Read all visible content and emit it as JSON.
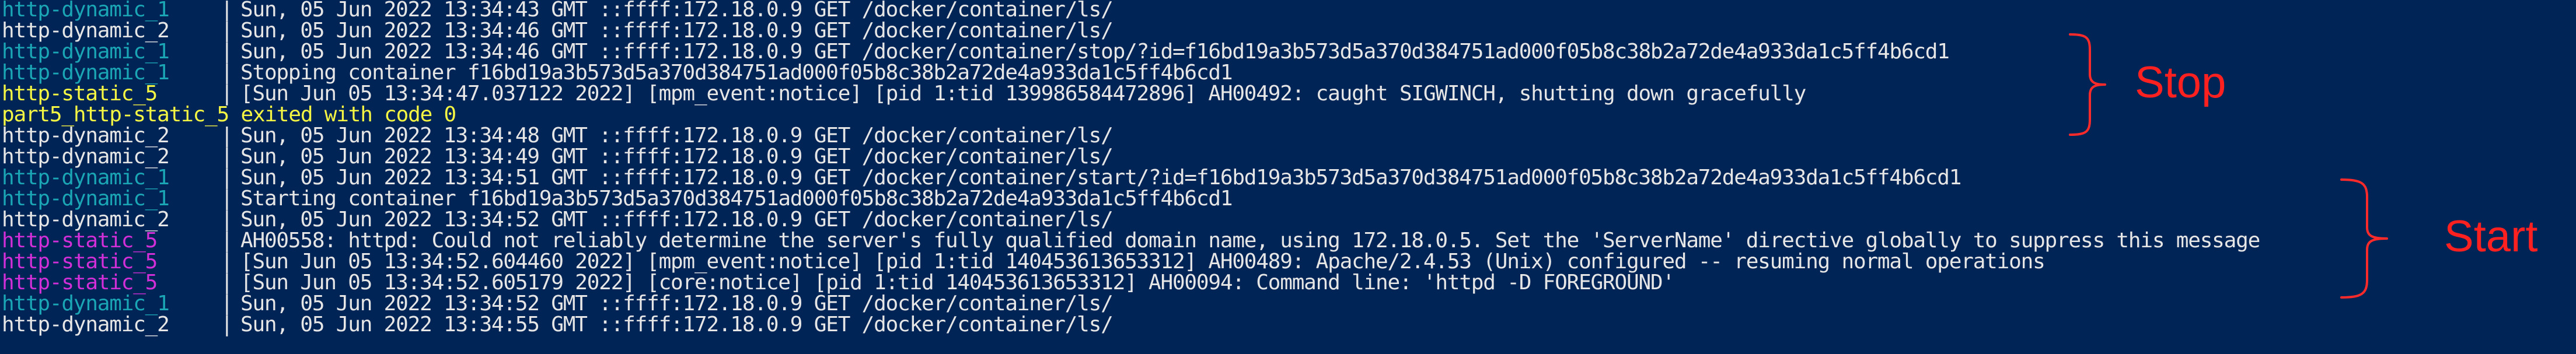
{
  "terminal": {
    "lines": [
      {
        "service": "http-dynamic_1",
        "service_color": "cyan",
        "separator": "|",
        "message": "Sun, 05 Jun 2022 13:34:43 GMT ::ffff:172.18.0.9 GET /docker/container/ls/"
      },
      {
        "service": "http-dynamic_2",
        "service_color": "white",
        "separator": "|",
        "message": "Sun, 05 Jun 2022 13:34:46 GMT ::ffff:172.18.0.9 GET /docker/container/ls/"
      },
      {
        "service": "http-dynamic_1",
        "service_color": "cyan",
        "separator": "|",
        "message": "Sun, 05 Jun 2022 13:34:46 GMT ::ffff:172.18.0.9 GET /docker/container/stop/?id=f16bd19a3b573d5a370d384751ad000f05b8c38b2a72de4a933da1c5ff4b6cd1"
      },
      {
        "service": "http-dynamic_1",
        "service_color": "cyan",
        "separator": "|",
        "message": "Stopping container f16bd19a3b573d5a370d384751ad000f05b8c38b2a72de4a933da1c5ff4b6cd1"
      },
      {
        "service": "http-static_5",
        "service_color": "yellow",
        "separator": "|",
        "message": "[Sun Jun 05 13:34:47.037122 2022] [mpm_event:notice] [pid 1:tid 139986584472896] AH00492: caught SIGWINCH, shutting down gracefully"
      },
      {
        "full_text": "part5_http-static_5 exited with code 0",
        "service_color": "yellow"
      },
      {
        "service": "http-dynamic_2",
        "service_color": "white",
        "separator": "|",
        "message": "Sun, 05 Jun 2022 13:34:48 GMT ::ffff:172.18.0.9 GET /docker/container/ls/"
      },
      {
        "service": "http-dynamic_2",
        "service_color": "white",
        "separator": "|",
        "message": "Sun, 05 Jun 2022 13:34:49 GMT ::ffff:172.18.0.9 GET /docker/container/ls/"
      },
      {
        "service": "http-dynamic_1",
        "service_color": "cyan",
        "separator": "|",
        "message": "Sun, 05 Jun 2022 13:34:51 GMT ::ffff:172.18.0.9 GET /docker/container/start/?id=f16bd19a3b573d5a370d384751ad000f05b8c38b2a72de4a933da1c5ff4b6cd1"
      },
      {
        "service": "http-dynamic_1",
        "service_color": "cyan",
        "separator": "|",
        "message": "Starting container f16bd19a3b573d5a370d384751ad000f05b8c38b2a72de4a933da1c5ff4b6cd1"
      },
      {
        "service": "http-dynamic_2",
        "service_color": "white",
        "separator": "|",
        "message": "Sun, 05 Jun 2022 13:34:52 GMT ::ffff:172.18.0.9 GET /docker/container/ls/"
      },
      {
        "service": "http-static_5",
        "service_color": "magenta",
        "separator": "|",
        "message": "AH00558: httpd: Could not reliably determine the server's fully qualified domain name, using 172.18.0.5. Set the 'ServerName' directive globally to suppress this message"
      },
      {
        "service": "http-static_5",
        "service_color": "magenta",
        "separator": "|",
        "message": "[Sun Jun 05 13:34:52.604460 2022] [mpm_event:notice] [pid 1:tid 140453613653312] AH00489: Apache/2.4.53 (Unix) configured -- resuming normal operations"
      },
      {
        "service": "http-static_5",
        "service_color": "magenta",
        "separator": "|",
        "message": "[Sun Jun 05 13:34:52.605179 2022] [core:notice] [pid 1:tid 140453613653312] AH00094: Command line: 'httpd -D FOREGROUND'"
      },
      {
        "service": "http-dynamic_1",
        "service_color": "cyan",
        "separator": "|",
        "message": "Sun, 05 Jun 2022 13:34:52 GMT ::ffff:172.18.0.9 GET /docker/container/ls/"
      },
      {
        "service": "http-dynamic_2",
        "service_color": "white",
        "separator": "|",
        "message": "Sun, 05 Jun 2022 13:34:55 GMT ::ffff:172.18.0.9 GET /docker/container/ls/"
      }
    ]
  },
  "annotations": {
    "stop_label": "Stop",
    "start_label": "Start",
    "color": "#ff2020"
  },
  "colors": {
    "background": "#012456",
    "white": "#e6e6e6",
    "cyan": "#1aa6b4",
    "yellow": "#f5f543",
    "magenta": "#d22fd8"
  }
}
